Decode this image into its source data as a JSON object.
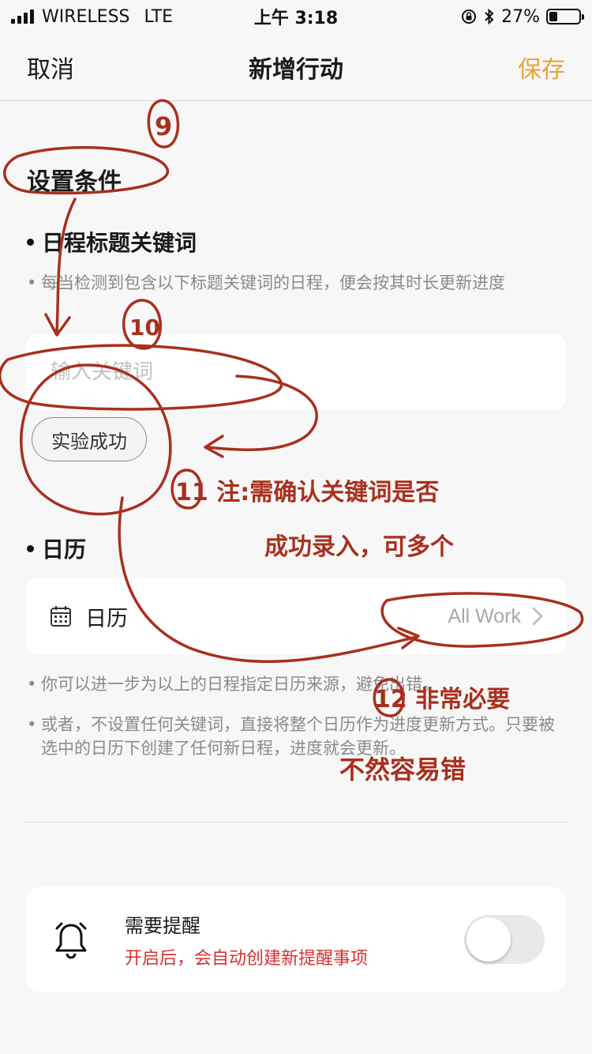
{
  "status_bar": {
    "carrier": "WIRELESS",
    "network": "LTE",
    "time": "上午 3:18",
    "battery_percent": "27%",
    "battery_level": 0.27
  },
  "nav": {
    "cancel_label": "取消",
    "title": "新增行动",
    "save_label": "保存",
    "save_color": "#e8a33a"
  },
  "conditions": {
    "section_title": "设置条件",
    "keyword": {
      "title": "日程标题关键词",
      "hint": "每当检测到包含以下标题关键词的日程，便会按其时长更新进度",
      "placeholder": "输入关键词",
      "value": "",
      "chips": [
        "实验成功"
      ]
    },
    "calendar": {
      "title": "日历",
      "row_label": "日历",
      "row_value": "All Work",
      "hint1": "你可以进一步为以上的日程指定日历来源，避免出错。",
      "hint2": "或者，不设置任何关键词，直接将整个日历作为进度更新方式。只要被选中的日历下创建了任何新日程，进度就会更新。"
    }
  },
  "reminder": {
    "title": "需要提醒",
    "subtitle": "开启后，会自动创建新提醒事项",
    "subtitle_color": "#d8302f",
    "enabled": false
  },
  "annotations": {
    "ink_color": "#a8301e",
    "n9": "9",
    "n10": "10",
    "note11_line1": "11 注:需确认关键词是否",
    "note11_line2": "成功录入，可多个",
    "note12_line1": "12 非常必要",
    "note12_line2": "不然容易错"
  }
}
